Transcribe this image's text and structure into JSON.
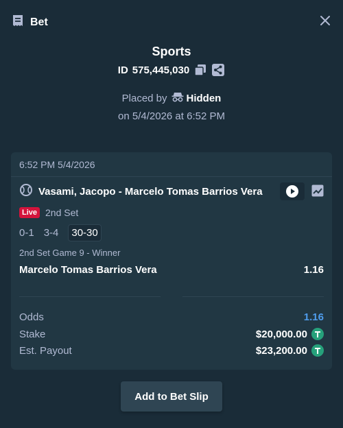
{
  "header": {
    "title": "Bet",
    "icon": "receipt-icon",
    "close_icon": "close-icon"
  },
  "bet": {
    "sport": "Sports",
    "id_label": "ID",
    "id_value": "575,445,030",
    "placed_by_label": "Placed by",
    "placed_by_user": "Hidden",
    "placed_on": "on 5/4/2026 at 6:52 PM"
  },
  "card": {
    "timestamp": "6:52 PM 5/4/2026",
    "match": "Vasami, Jacopo - Marcelo Tomas Barrios Vera",
    "live_label": "Live",
    "period": "2nd Set",
    "scores": [
      "0-1",
      "3-4",
      "30-30"
    ],
    "market": "2nd Set Game 9 - Winner",
    "selection": "Marcelo Tomas Barrios Vera",
    "selection_odds": "1.16",
    "summary": {
      "odds_label": "Odds",
      "odds_value": "1.16",
      "stake_label": "Stake",
      "stake_value": "$20,000.00",
      "payout_label": "Est. Payout",
      "payout_value": "$23,200.00"
    }
  },
  "actions": {
    "add_to_slip": "Add to Bet Slip"
  },
  "colors": {
    "background": "#1a2c38",
    "card": "#213743",
    "accent_blue": "#4f9ded",
    "live_red": "#d4143c",
    "tether_green": "#26a17b"
  }
}
